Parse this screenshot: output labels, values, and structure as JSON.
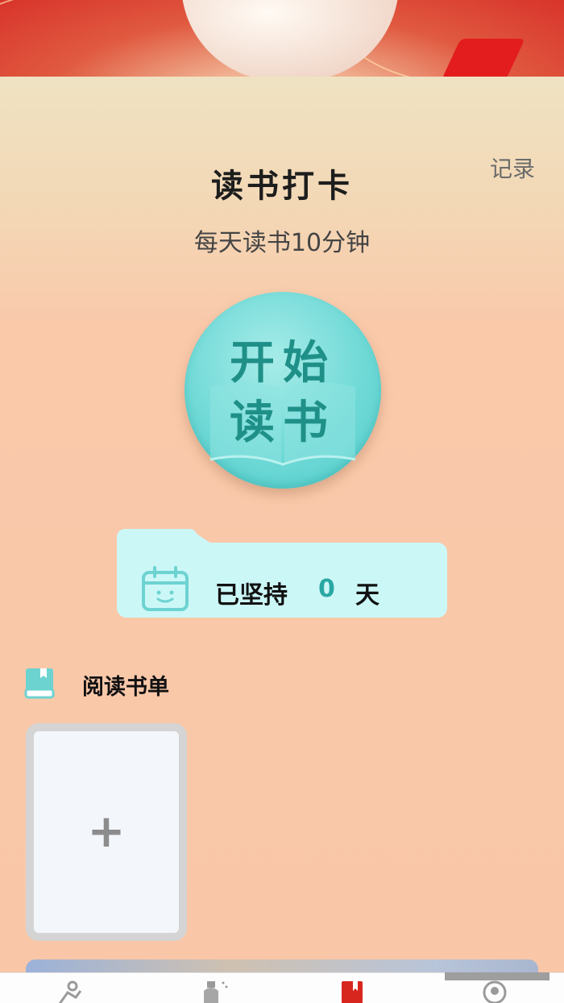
{
  "header": {
    "record_link": "记录",
    "title": "读书打卡",
    "subtitle": "每天读书10分钟"
  },
  "start_button": {
    "line1": "开始",
    "line2": "读书"
  },
  "streak": {
    "label": "已坚持",
    "count": "0",
    "unit": "天"
  },
  "reading_list": {
    "title": "阅读书单",
    "add_symbol": "+"
  },
  "tabbar": {
    "items": [
      {
        "icon": "exercise-icon",
        "active": false
      },
      {
        "icon": "bottle-icon",
        "active": false
      },
      {
        "icon": "bookmark-book-icon",
        "active": true
      },
      {
        "icon": "profile-icon",
        "active": false
      }
    ]
  },
  "colors": {
    "background": "#f9c7a8",
    "accent_teal": "#2aa7a3",
    "card_teal": "#ccf7f7",
    "active_tab_red": "#d7261e"
  }
}
